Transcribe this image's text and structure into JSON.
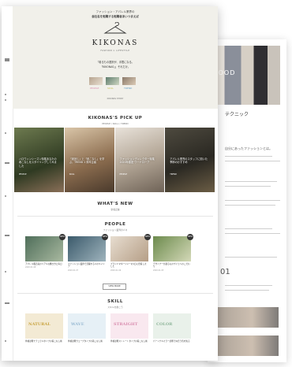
{
  "hero": {
    "tagline": "ファッション・アパレル業界の",
    "headline": "会社名を転職する転職者あいつまえば",
    "logo": "KIKONAS",
    "logo_sub": "FASHION × LIFESTYLE",
    "copy_line1": "「着るもの選択が、手間になる。",
    "copy_line2": "「KIKONAS」」それだけ。",
    "copy_line3": "",
    "thumbs": [
      {
        "label": "PEOPLE",
        "color": "#d98fb0"
      },
      {
        "label": "SKILL",
        "color": "#c9c35a"
      },
      {
        "label": "TREND",
        "color": "#6aa3c9"
      }
    ],
    "more": "KIKONAS STORY"
  },
  "pickup": {
    "title": "KIKONAS'S PICK UP",
    "sub": "PEOPLE / SKILL / TREND",
    "items": [
      {
        "caption": "ハロウィンシーズン特集あなたの着こなしをスタイリングしてみました",
        "tag": "PEOPLE"
      },
      {
        "caption": "「着回し」と「着こなし」を学ぶ、TREND 1 周年企画",
        "tag": "SKILL"
      },
      {
        "caption": "ファッションディレクター特集 2020年春夏 ワードローブ",
        "tag": "PEOPLE"
      },
      {
        "caption": "アパレル業界のスタッフに聞いた季節のおすすめ",
        "tag": "TREND"
      }
    ]
  },
  "whatsnew": {
    "title": "WHAT'S NEW",
    "sub": "新着記事"
  },
  "people": {
    "title": "PEOPLE",
    "sub": "ファッション業界の人々",
    "cards": [
      {
        "caption": "アパレル販売員のリアルな働き方と毎日",
        "meta": "2020.01.08",
        "badge": "NEW"
      },
      {
        "caption": "ファッション業界で活躍する人のキャリア",
        "meta": "2020.01.07",
        "badge": "NEW"
      },
      {
        "caption": "ブランドマネージャーの1日に密着しました",
        "meta": "2020.01.06",
        "badge": "NEW"
      },
      {
        "caption": "デザイナーが語るものづくりへのこだわり",
        "meta": "2020.01.05",
        "badge": "NEW"
      }
    ],
    "more": "VIEW MORE"
  },
  "skill": {
    "title": "SKILL",
    "sub": "スキルを磨こう",
    "cards": [
      {
        "label": "NATURAL",
        "caption": "骨格診断ナチュラルタイプの着こなし術",
        "color": "#c9a441"
      },
      {
        "label": "WAVE",
        "caption": "骨格診断ウェーブタイプの着こなし術",
        "color": "#9bbcd4"
      },
      {
        "label": "STRAIGHT",
        "caption": "骨格診断ストレートタイプの着こなし術",
        "color": "#d98fb0"
      },
      {
        "label": "COLOR",
        "caption": "パーソナルカラー診断で似合う色を知る",
        "color": "#8fb59a"
      }
    ]
  },
  "back": {
    "photo_text": "FOOD",
    "heading": "テクニック",
    "body": "自分にあったファッションとは。",
    "number": "01"
  },
  "colors": {
    "hero_bg": "#f1f0ea",
    "accent": "#333333"
  }
}
